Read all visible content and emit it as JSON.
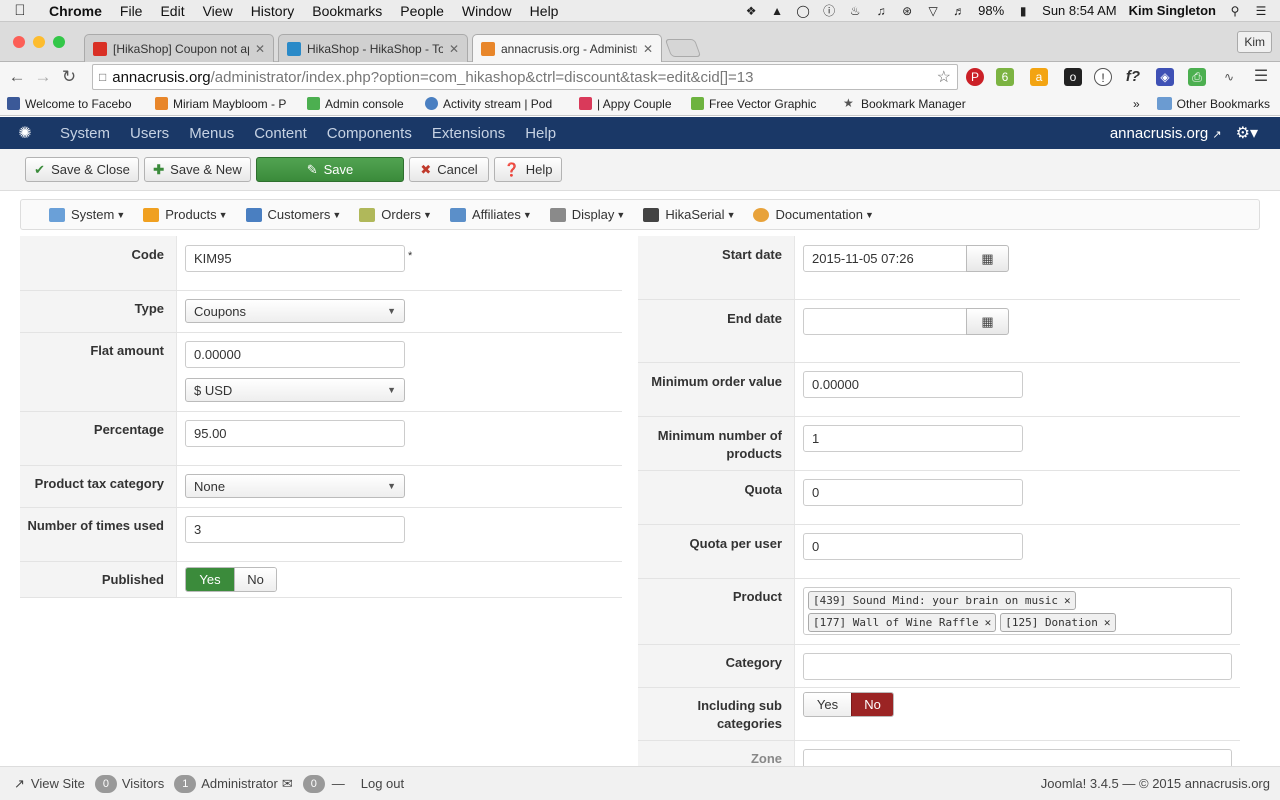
{
  "mac_menu": {
    "app": "Chrome",
    "items": [
      "File",
      "Edit",
      "View",
      "History",
      "Bookmarks",
      "People",
      "Window",
      "Help"
    ],
    "battery": "98%",
    "clock": "Sun 8:54 AM",
    "user": "Kim Singleton"
  },
  "tabs": [
    {
      "title": "[HikaShop] Coupon not ap",
      "favicon_color": "#d93025"
    },
    {
      "title": "HikaShop - HikaShop - Top",
      "favicon_color": "#2a8ac8"
    },
    {
      "title": "annacrusis.org - Administr",
      "favicon_color": "#e8862a"
    }
  ],
  "profile_button": "Kim",
  "url": {
    "host": "annacrusis.org",
    "path": "/administrator/index.php?option=com_hikashop&ctrl=discount&task=edit&cid[]=13"
  },
  "bookmarks": [
    {
      "label": "Welcome to Facebo",
      "color": "#3b5998"
    },
    {
      "label": "Miriam Maybloom - P",
      "color": "#e8862a"
    },
    {
      "label": "Admin console",
      "color": "#4caf50"
    },
    {
      "label": "Activity stream | Pod",
      "color": "#4a7fc1"
    },
    {
      "label": "| Appy Couple",
      "color": "#d93a5a"
    },
    {
      "label": "Free Vector Graphic",
      "color": "#6db33f"
    },
    {
      "label": "Bookmark Manager",
      "color": "#555555"
    }
  ],
  "other_bookmarks": "Other Bookmarks",
  "joomla_nav": {
    "items": [
      "System",
      "Users",
      "Menus",
      "Content",
      "Components",
      "Extensions",
      "Help"
    ],
    "site": "annacrusis.org"
  },
  "actions": {
    "save_close": "Save & Close",
    "save_new": "Save & New",
    "save": "Save",
    "cancel": "Cancel",
    "help": "Help"
  },
  "hika_menu": [
    "System",
    "Products",
    "Customers",
    "Orders",
    "Affiliates",
    "Display",
    "HikaSerial",
    "Documentation"
  ],
  "form_left": {
    "code": {
      "label": "Code",
      "value": "KIM95",
      "required": "*"
    },
    "type": {
      "label": "Type",
      "value": "Coupons"
    },
    "flat_amount": {
      "label": "Flat amount",
      "value": "0.00000",
      "currency": "$ USD"
    },
    "percentage": {
      "label": "Percentage",
      "value": "95.00"
    },
    "tax_category": {
      "label": "Product tax category",
      "value": "None"
    },
    "times_used": {
      "label": "Number of times used",
      "value": "3"
    },
    "published": {
      "label": "Published",
      "yes": "Yes",
      "no": "No"
    }
  },
  "form_right": {
    "start_date": {
      "label": "Start date",
      "value": "2015-11-05 07:26"
    },
    "end_date": {
      "label": "End date",
      "value": ""
    },
    "min_order": {
      "label": "Minimum order value",
      "value": "0.00000"
    },
    "min_products": {
      "label": "Minimum number of products",
      "value": "1"
    },
    "quota": {
      "label": "Quota",
      "value": "0"
    },
    "quota_user": {
      "label": "Quota per user",
      "value": "0"
    },
    "product": {
      "label": "Product",
      "tags": [
        "[439] Sound Mind: your brain on music",
        "[177] Wall of Wine Raffle",
        "[125] Donation"
      ]
    },
    "category": {
      "label": "Category",
      "value": ""
    },
    "sub_categories": {
      "label": "Including sub categories",
      "yes": "Yes",
      "no": "No"
    },
    "zone": {
      "label": "Zone"
    }
  },
  "status": {
    "view_site": "View Site",
    "visitors_count": "0",
    "visitors": "Visitors",
    "admin_count": "1",
    "admin": "Administrator",
    "msg_count": "0",
    "logout": "Log out",
    "version": "Joomla! 3.4.5 — © 2015 annacrusis.org"
  }
}
